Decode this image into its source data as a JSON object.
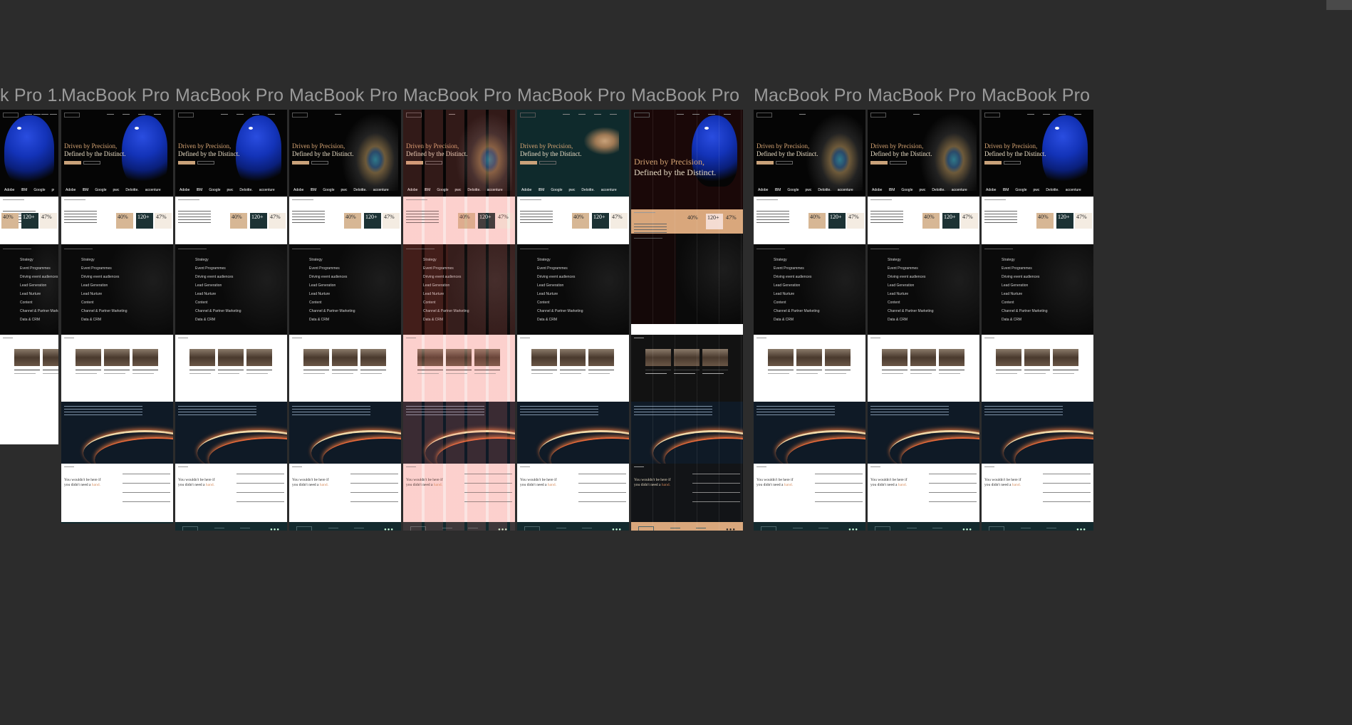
{
  "canvas": {
    "background": "#2c2c2c",
    "title_color": "#9a9a9a"
  },
  "frames": [
    {
      "title": "k Pro 1..."
    },
    {
      "title": "MacBook Pro 1..."
    },
    {
      "title": "MacBook Pro 1..."
    },
    {
      "title": "MacBook Pro 1..."
    },
    {
      "title": "MacBook Pro 1..."
    },
    {
      "title": "MacBook Pro 1..."
    },
    {
      "title": "MacBook Pro 1..."
    },
    {
      "title": "MacBook Pro 1..."
    },
    {
      "title": "MacBook Pro 1..."
    },
    {
      "title": "MacBook Pro 1..."
    }
  ],
  "design": {
    "hero_line1": "Driven by Precision,",
    "hero_line2": "Defined by the Distinct.",
    "logos": [
      "Adobe",
      "IBM",
      "Google",
      "pwc",
      "Deloitte.",
      "accenture"
    ],
    "stats": [
      "40%",
      "120+",
      "47%"
    ],
    "services": [
      "Strategy",
      "Event Programmes",
      "Driving event audiences",
      "Lead Generation",
      "Lead Nurture",
      "Content",
      "Channel & Partner Marketing",
      "Data & CRM"
    ],
    "contact_line1": "You wouldn't be here if",
    "contact_line2_prefix": "you didn't need a ",
    "contact_line2_accent": "hand.",
    "footer_dots": "●●●"
  },
  "colors": {
    "accent_gold": "#d4a373",
    "card_tan": "#d7b795",
    "card_teal": "#1c3234",
    "footer_teal": "#132a2e",
    "peacock_blue": "#1333b8"
  }
}
